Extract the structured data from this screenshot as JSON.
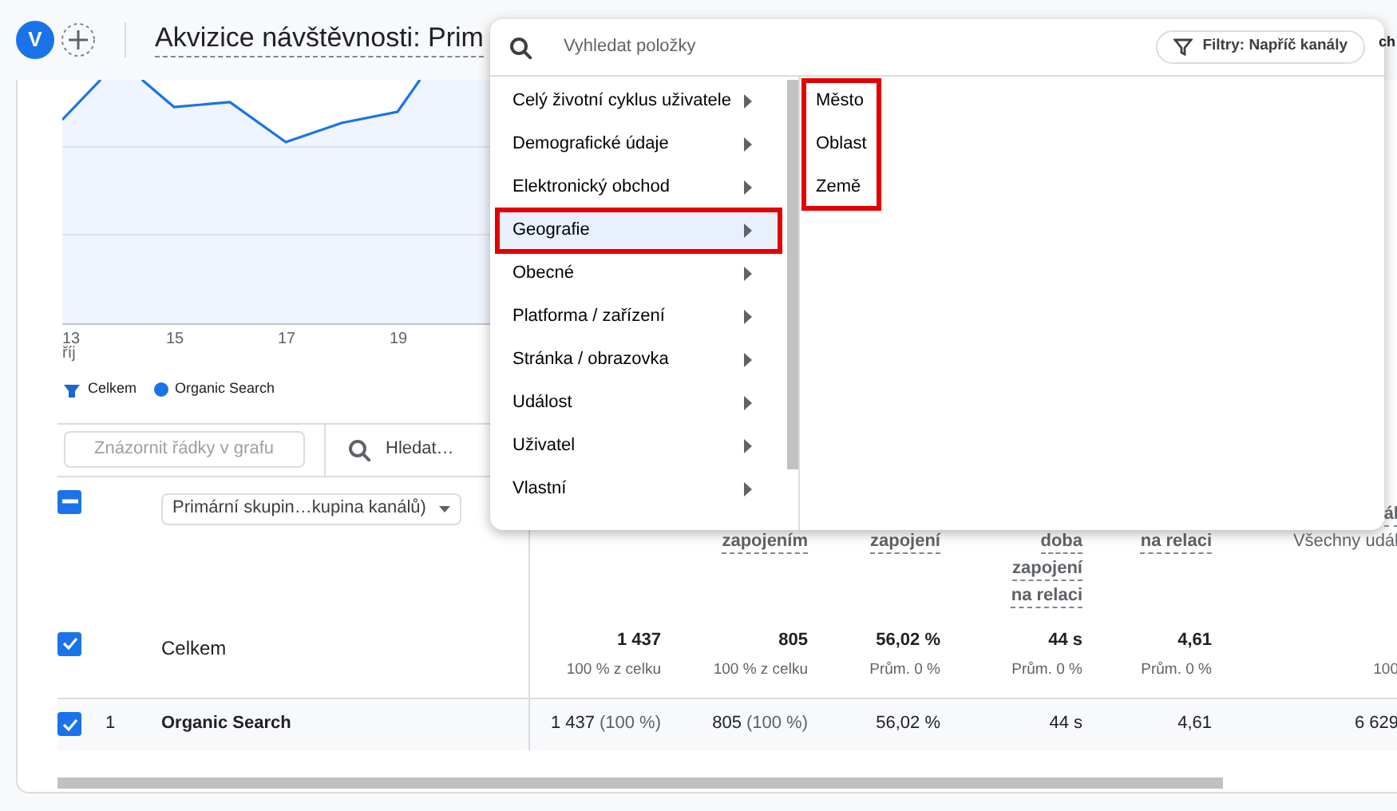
{
  "header": {
    "avatar": "V",
    "title": "Akvizice návštěvnosti: Prim",
    "cut_text": "ch"
  },
  "chart": {
    "x_labels": [
      "13",
      "15",
      "17",
      "19"
    ],
    "month_label": "říj",
    "legend": [
      {
        "label": "Celkem",
        "kind": "total",
        "color": "#1967d2"
      },
      {
        "label": "Organic Search",
        "kind": "series",
        "color": "#1a73e8"
      }
    ]
  },
  "table": {
    "plot_rows_button": {
      "label": "Znázornit řádky v grafu",
      "disabled": true
    },
    "search_placeholder": "Hledat…",
    "select_all": {
      "indeterminate": true
    },
    "dimension_dropdown": "Primární skupin…kupina kanálů)",
    "columns": [
      {},
      {
        "lines": [
          "zapojením"
        ]
      },
      {
        "lines": [
          "zapojení"
        ]
      },
      {
        "lines": [
          "doba",
          "zapojení",
          "na relaci"
        ]
      },
      {
        "lines": [
          "na relaci"
        ]
      },
      {
        "lines": [
          "ál",
          "Všechny udál"
        ]
      }
    ],
    "totals": {
      "checked": true,
      "label": "Celkem",
      "cells": [
        {
          "value": "1 437",
          "note": "100 % z celku"
        },
        {
          "value": "805",
          "note": "100 % z celku"
        },
        {
          "value": "56,02 %",
          "note": "Prům. 0 %"
        },
        {
          "value": "44 s",
          "note": "Prům. 0 %"
        },
        {
          "value": "4,61",
          "note": "Prům. 0 %"
        },
        {
          "note": "100"
        }
      ]
    },
    "rows": [
      {
        "checked": true,
        "index": "1",
        "name": "Organic Search",
        "cells": [
          {
            "value": "1 437",
            "share": "(100 %)"
          },
          {
            "value": "805",
            "share": "(100 %)"
          },
          {
            "value": "56,02 %"
          },
          {
            "value": "44 s"
          },
          {
            "value": "4,61"
          },
          {
            "value": "6 629"
          }
        ]
      }
    ]
  },
  "menu": {
    "search_placeholder": "Vyhledat položky",
    "filter_chip": "Filtry: Napříč kanály",
    "categories": [
      {
        "label": "Celý životní cyklus uživatele",
        "selected": false,
        "highlighted": false
      },
      {
        "label": "Demografické údaje",
        "selected": false,
        "highlighted": false
      },
      {
        "label": "Elektronický obchod",
        "selected": false,
        "highlighted": false
      },
      {
        "label": "Geografie",
        "selected": true,
        "highlighted": true
      },
      {
        "label": "Obecné",
        "selected": false,
        "highlighted": false
      },
      {
        "label": "Platforma / zařízení",
        "selected": false,
        "highlighted": false
      },
      {
        "label": "Stránka / obrazovka",
        "selected": false,
        "highlighted": false
      },
      {
        "label": "Událost",
        "selected": false,
        "highlighted": false
      },
      {
        "label": "Uživatel",
        "selected": false,
        "highlighted": false
      },
      {
        "label": "Vlastní",
        "selected": false,
        "highlighted": false
      }
    ],
    "submenu": {
      "highlighted": true,
      "items": [
        "Město",
        "Oblast",
        "Země"
      ]
    }
  }
}
